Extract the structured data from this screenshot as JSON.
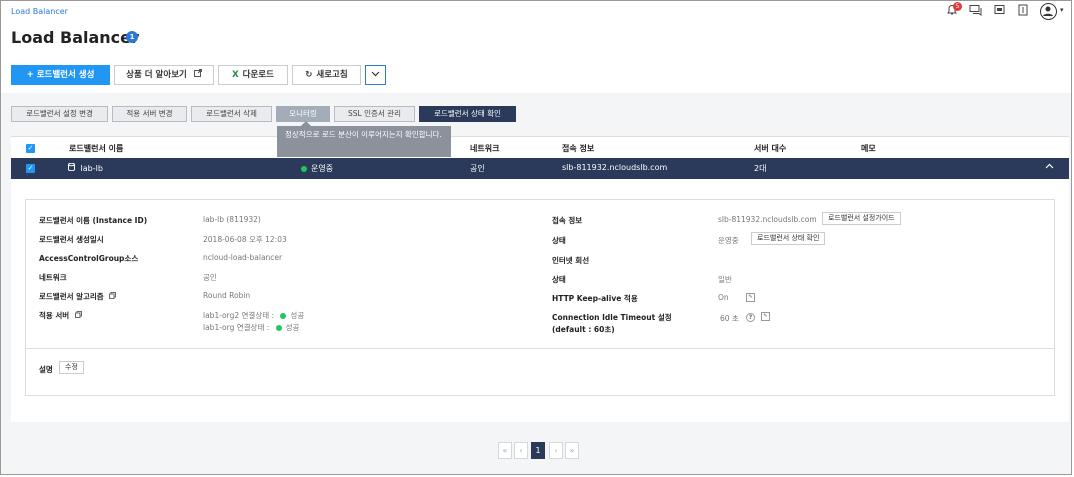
{
  "breadcrumb": "Load Balancer",
  "page": {
    "title": "Load Balancer",
    "badge": "1"
  },
  "header": {
    "notification_count": "5"
  },
  "toolbar": {
    "create": "+ 로드밸런서 생성",
    "learn_more": "상품 더 알아보기",
    "download": "다운로드",
    "refresh": "새로고침"
  },
  "actions": {
    "settings_change": "로드밸런서 설정 변경",
    "server_change": "적용 서버 변경",
    "delete": "로드밸런서 삭제",
    "monitoring": "모니터링",
    "ssl": "SSL 인증서 관리",
    "status_check": "로드밸런서 상태 확인"
  },
  "tooltip": {
    "text": "정상적으로 로드 분산이 이루어지는지 확인합니다."
  },
  "table": {
    "columns": [
      "로드밸런서 이름",
      "네트워크",
      "접속 정보",
      "서버 대수",
      "메모"
    ],
    "row": {
      "name": "lab-lb",
      "status": "운영중",
      "network": "공인",
      "endpoint": "slb-811932.ncloudslb.com",
      "servers": "2대"
    }
  },
  "detail": {
    "left": [
      {
        "label": "로드밸런서 이름 (Instance ID)",
        "value": "lab-lb (811932)"
      },
      {
        "label": "로드밸런서 생성일시",
        "value": "2018-06-08 오후 12:03"
      },
      {
        "label": "AccessControlGroup소스",
        "value": "ncloud-load-balancer"
      },
      {
        "label": "네트워크",
        "value": "공인"
      },
      {
        "label": "로드밸런서 알고리즘",
        "value": "Round Robin"
      },
      {
        "label": "적용 서버",
        "value": ""
      }
    ],
    "servers": [
      {
        "name": "lab1-org2 연결상태 :",
        "status": "성공"
      },
      {
        "name": "lab1-org 연결상태 :",
        "status": "성공"
      }
    ],
    "right": {
      "endpoint_label": "접속 정보",
      "endpoint_value": "slb-811932.ncloudslb.com",
      "guide_button": "로드밸런서 설정가이드",
      "status_label": "상태",
      "status_value": "운영중",
      "status_button": "로드밸런서 상태 확인",
      "internet_label": "인터넷 회선",
      "line_status_label": "상태",
      "line_status_value": "일반",
      "keepalive_label": "HTTP Keep-alive 적용",
      "keepalive_value": "On",
      "timeout_label": "Connection Idle Timeout 설정",
      "timeout_default": "(default : 60초)",
      "timeout_value": "60 초"
    },
    "memo_label": "설명",
    "memo_edit": "수정"
  },
  "pagination": {
    "first": "«",
    "prev": "‹",
    "current": "1",
    "next": "›",
    "last": "»"
  },
  "colors": {
    "primary": "#2196f3",
    "navy": "#2b3a5a",
    "success": "#22c55e",
    "alert": "#e53935"
  }
}
